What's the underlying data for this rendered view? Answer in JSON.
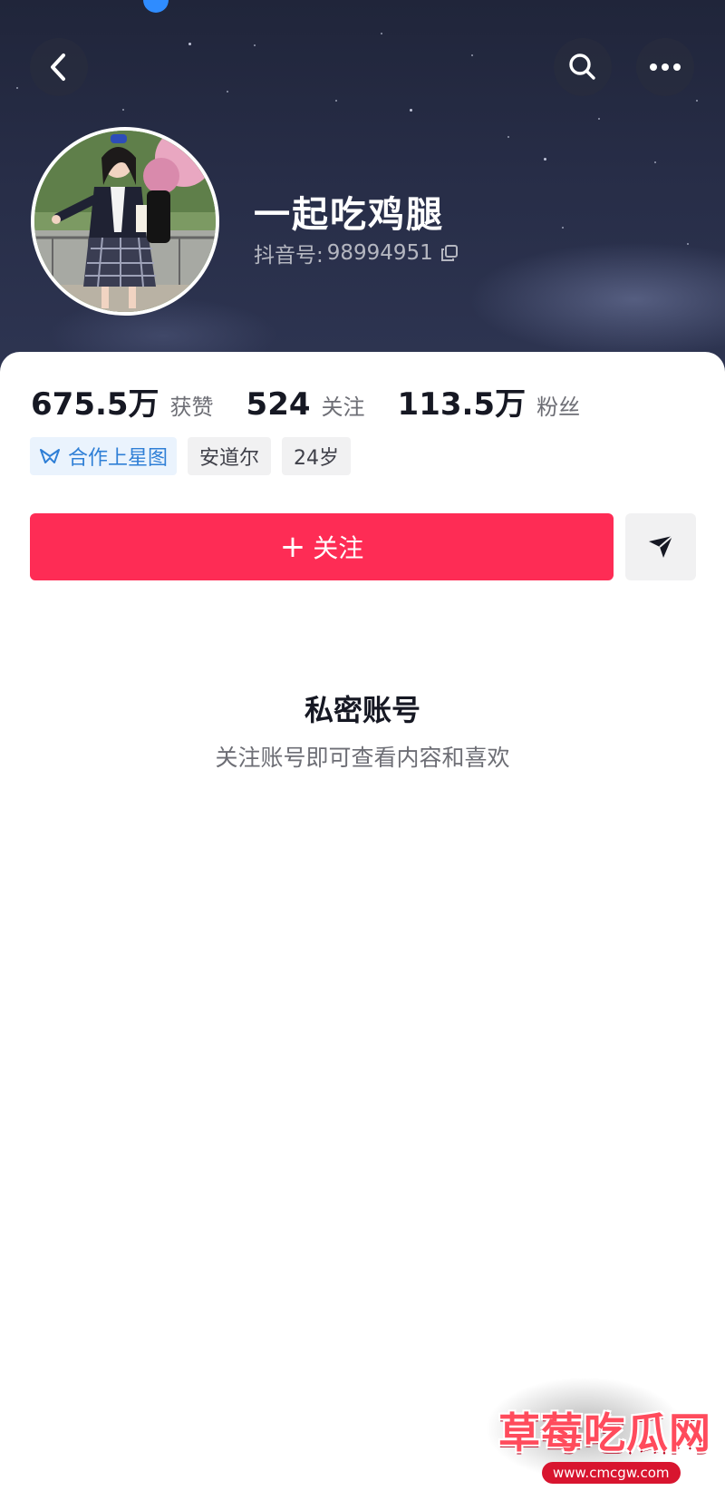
{
  "header": {
    "icons": {
      "back": "chevron-left-icon",
      "search": "search-icon",
      "more": "more-horizontal-icon"
    },
    "nickname": "一起吃鸡腿",
    "douyin_id_label": "抖音号:",
    "douyin_id_value": "98994951",
    "copy_icon": "copy-icon"
  },
  "stats": [
    {
      "value": "675.5万",
      "label": "获赞"
    },
    {
      "value": "524",
      "label": "关注"
    },
    {
      "value": "113.5万",
      "label": "粉丝"
    }
  ],
  "tags": {
    "star": "合作上星图",
    "location": "安道尔",
    "age": "24岁"
  },
  "actions": {
    "follow_plus": "+",
    "follow_label": "关注",
    "share_icon": "send-icon"
  },
  "private": {
    "title": "私密账号",
    "subtitle": "关注账号即可查看内容和喜欢"
  },
  "watermark": {
    "text": "草莓吃瓜网",
    "url": "www.cmcgw.com"
  },
  "colors": {
    "accent": "#fe2c55",
    "cover_dark": "#252a42",
    "star_tag": "#2f7fd6"
  }
}
